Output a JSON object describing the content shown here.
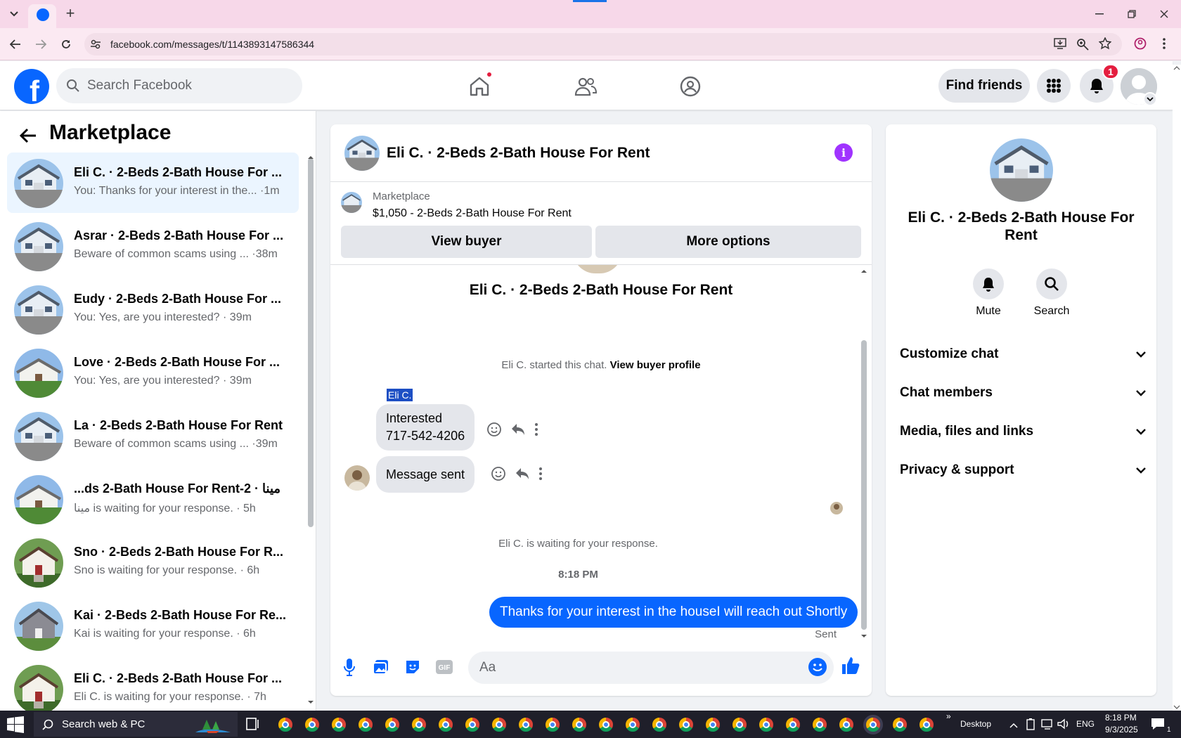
{
  "browser": {
    "url": "facebook.com/messages/t/1143893147586344"
  },
  "topbar": {
    "logo": "f",
    "search_placeholder": "Search Facebook",
    "find_friends": "Find friends",
    "notif_count": "1"
  },
  "sidebar": {
    "title": "Marketplace",
    "conversations": [
      {
        "title": "Eli C. · 2-Beds 2-Bath House For ...",
        "snippet": "You: Thanks for your interest in the... ·1m"
      },
      {
        "title": "Asrar · 2-Beds 2-Bath House For ...",
        "snippet": "Beware of common scams using ... ·38m"
      },
      {
        "title": "Eudy · 2-Beds 2-Bath House For ...",
        "snippet": "You: Yes, are you interested? · 39m"
      },
      {
        "title": "Love · 2-Beds 2-Bath House For ...",
        "snippet": "You: Yes, are you interested? · 39m"
      },
      {
        "title": "La · 2-Beds 2-Bath House For Rent",
        "snippet": "Beware of common scams using ... ·39m"
      },
      {
        "title": "...ds 2-Bath House For Rent-2 · مينا",
        "snippet": "مينا is waiting for your response. · 5h"
      },
      {
        "title": "Sno · 2-Beds 2-Bath House For R...",
        "snippet": "Sno is waiting for your response. · 6h"
      },
      {
        "title": "Kai · 2-Beds 2-Bath House For Re...",
        "snippet": "Kai is waiting for your response. · 6h"
      },
      {
        "title": "Eli C. · 2-Beds 2-Bath House For ...",
        "snippet": "Eli C. is waiting for your response. · 7h"
      }
    ]
  },
  "chat": {
    "header_title": "Eli C. · 2-Beds 2-Bath House For Rent",
    "listing_source": "Marketplace",
    "listing_title": "$1,050 - 2-Beds 2-Bath House For Rent",
    "view_buyer": "View buyer",
    "more_options": "More options",
    "intro_title": "Eli C. · 2-Beds 2-Bath House For Rent",
    "started_text": "Eli C. started this chat.",
    "view_buyer_profile": "View buyer profile",
    "sender_name": "Eli C.",
    "msg1_line1": "Interested",
    "msg1_line2": "717-542-4206",
    "msg2": "Message sent",
    "waiting_text": "Eli C. is waiting for your response.",
    "timestamp": "8:18 PM",
    "my_message": "Thanks for your interest in the houseI will reach out Shortly",
    "sent_status": "Sent",
    "composer_placeholder": "Aa",
    "accent": "#0866ff"
  },
  "info": {
    "name": "Eli C. · 2-Beds 2-Bath House For Rent",
    "mute": "Mute",
    "search": "Search",
    "rows": [
      "Customize chat",
      "Chat members",
      "Media, files and links",
      "Privacy & support"
    ]
  },
  "taskbar": {
    "search": "Search web & PC",
    "desktop": "Desktop",
    "lang": "ENG",
    "time": "8:18 PM",
    "date": "9/3/2025",
    "notif": "1"
  }
}
